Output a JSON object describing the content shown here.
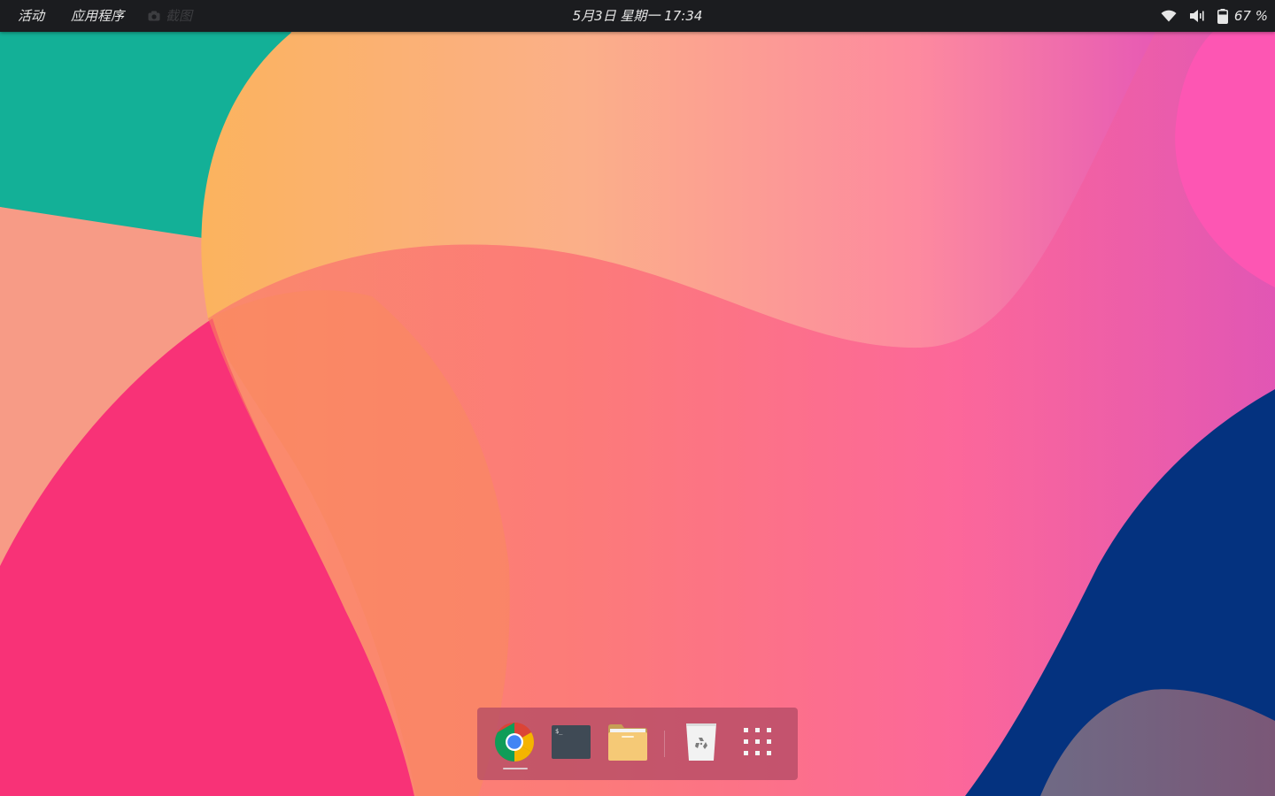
{
  "top_bar": {
    "activities_label": "活动",
    "applications_label": "应用程序",
    "screenshot_app_label": "截图",
    "clock_text": "5月3日 星期一 17:34",
    "battery_percent": "67 %"
  },
  "tray_icons": [
    "wifi-icon",
    "volume-icon",
    "battery-icon"
  ],
  "dock": {
    "items": [
      "chrome-icon",
      "terminal-icon",
      "files-icon",
      "trash-icon",
      "show-apps-grid-icon"
    ],
    "running_app": "chrome-icon"
  },
  "wallpaper_colors": {
    "teal": "#13b097",
    "peach": "#f79b86",
    "orange": "#fbb760",
    "pink": "#fd6d93",
    "hot_pink": "#f83277",
    "magenta": "#fd56b3",
    "navy": "#04327f",
    "mauve": "#765a78"
  }
}
